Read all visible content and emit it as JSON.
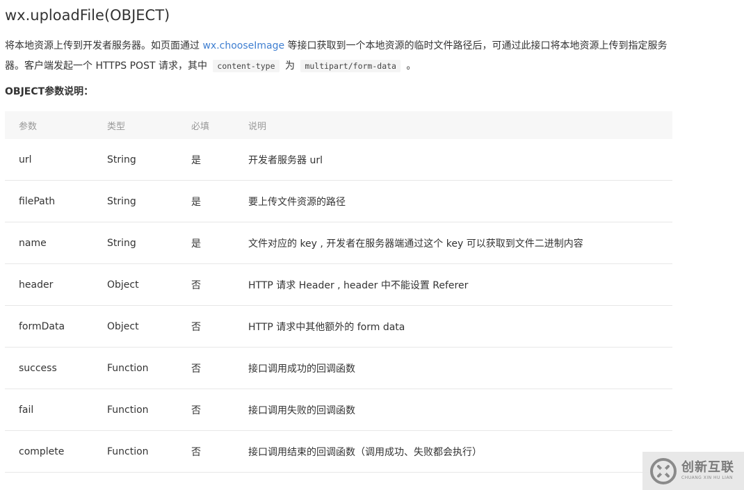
{
  "title": "wx.uploadFile(OBJECT)",
  "description": {
    "part1": "将本地资源上传到开发者服务器。如页面通过 ",
    "link": "wx.chooseImage",
    "part2": " 等接口获取到一个本地资源的临时文件路径后，可通过此接口将本地资源上传到指定服务器。客户端发起一个 HTTPS POST 请求，其中 ",
    "code1": "content-type",
    "part3": " 为 ",
    "code2": "multipart/form-data",
    "part4": " 。"
  },
  "subheading": "OBJECT参数说明：",
  "table": {
    "headers": [
      "参数",
      "类型",
      "必填",
      "说明"
    ],
    "rows": [
      [
        "url",
        "String",
        "是",
        "开发者服务器 url"
      ],
      [
        "filePath",
        "String",
        "是",
        "要上传文件资源的路径"
      ],
      [
        "name",
        "String",
        "是",
        "文件对应的 key , 开发者在服务器端通过这个 key 可以获取到文件二进制内容"
      ],
      [
        "header",
        "Object",
        "否",
        "HTTP 请求 Header , header 中不能设置 Referer"
      ],
      [
        "formData",
        "Object",
        "否",
        "HTTP 请求中其他额外的 form data"
      ],
      [
        "success",
        "Function",
        "否",
        "接口调用成功的回调函数"
      ],
      [
        "fail",
        "Function",
        "否",
        "接口调用失败的回调函数"
      ],
      [
        "complete",
        "Function",
        "否",
        "接口调用结束的回调函数（调用成功、失败都会执行）"
      ]
    ]
  },
  "watermark": {
    "cn": "创新互联",
    "en": "CHUANG XIN HU LIAN",
    "icon": "brand-logo-icon"
  }
}
